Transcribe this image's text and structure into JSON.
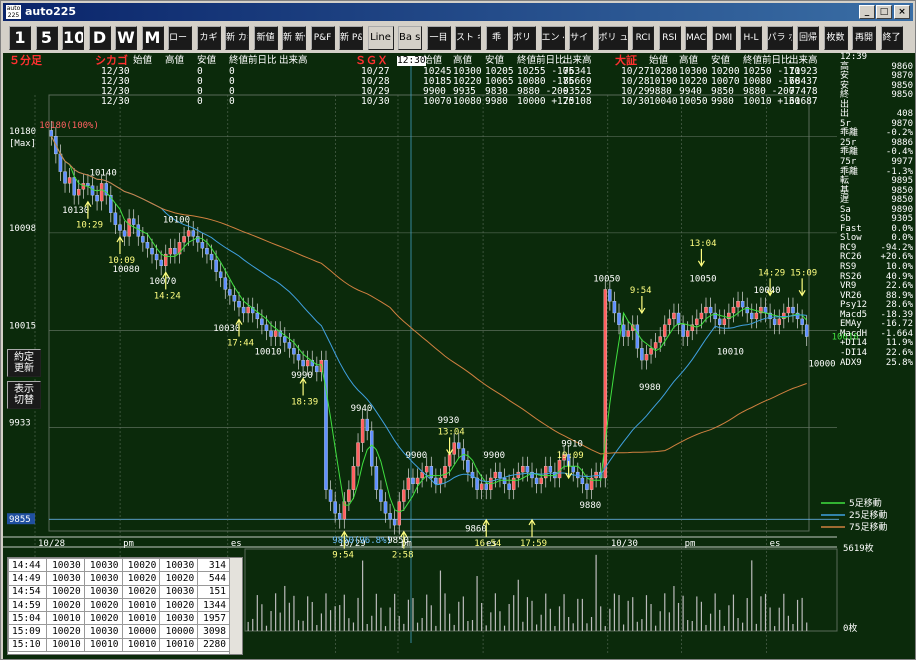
{
  "window": {
    "title": "auto225",
    "icon_text": "auto 225"
  },
  "toolbar": {
    "buttons": [
      "1",
      "5",
      "10",
      "D",
      "W",
      "M",
      "ロー ソク",
      "カギ",
      "新 カギ",
      "新値",
      "新 新値",
      "P&F",
      "新 P&F",
      "Line",
      "Ba sic",
      "一目",
      "スト キャス",
      "乖",
      "ボリ ン",
      "エン ベ",
      "サイ コ",
      "ボリ ューム",
      "RCI",
      "RSI",
      "MAC",
      "DMI",
      "H-L",
      "パラ ボリ",
      "回帰",
      "枚数",
      "再開",
      "終了"
    ]
  },
  "chart_header": {
    "period_label": "５分足",
    "chicago": {
      "label": "シカゴ",
      "cols": [
        "始値",
        "高値",
        "安値",
        "終値前日比",
        "出来高"
      ],
      "rows": [
        [
          "12/30",
          "",
          "",
          "0",
          "0"
        ],
        [
          "12/30",
          "",
          "",
          "0",
          "0"
        ],
        [
          "12/30",
          "",
          "",
          "0",
          "0"
        ],
        [
          "12/30",
          "",
          "",
          "0",
          "0"
        ]
      ]
    },
    "sgx": {
      "label": "ＳＧＸ",
      "time_badge": "12:30",
      "cols": [
        "始値",
        "高値",
        "安値",
        "終値前日比",
        "出来高"
      ],
      "rows": [
        [
          "10/27",
          "10245",
          "10300",
          "10205",
          "10255 -105",
          "76341"
        ],
        [
          "10/28",
          "10185",
          "10220",
          "10065",
          "10080 -175",
          "86669"
        ],
        [
          "10/29",
          "9900",
          "9935",
          "9830",
          "9880 -200",
          "93525"
        ],
        [
          "10/30",
          "10070",
          "10080",
          "9980",
          "10000 +120",
          "75108"
        ]
      ]
    },
    "osaka": {
      "label": "大証",
      "cols": [
        "始値",
        "高値",
        "安値",
        "終値前日比",
        "出来高"
      ],
      "rows": [
        [
          "10/27",
          "10280",
          "10300",
          "10200",
          "10250 -110",
          "71923"
        ],
        [
          "10/28",
          "10190",
          "10220",
          "10070",
          "10080 -170",
          "68437"
        ],
        [
          "10/29",
          "9880",
          "9940",
          "9850",
          "9880 -200",
          "77478"
        ],
        [
          "10/30",
          "10040",
          "10050",
          "9980",
          "10010 +130",
          "61687"
        ]
      ]
    }
  },
  "right_panel": [
    [
      "12:39",
      ""
    ],
    [
      "高",
      "9860"
    ],
    [
      "安",
      "9870"
    ],
    [
      "安",
      "9850"
    ],
    [
      "終",
      "9850"
    ],
    [
      "出",
      ""
    ],
    [
      "出",
      "408"
    ],
    [
      "5r",
      "9870"
    ],
    [
      "乖離",
      "-0.2%"
    ],
    [
      "25r",
      "9886"
    ],
    [
      "乖離",
      "-0.4%"
    ],
    [
      "75r",
      "9977"
    ],
    [
      "乖離",
      "-1.3%"
    ],
    [
      "転",
      "9895"
    ],
    [
      "基",
      "9850"
    ],
    [
      "遅",
      "9850"
    ],
    [
      "Sa",
      "9890"
    ],
    [
      "Sb",
      "9305"
    ],
    [
      "Fast",
      "0.0%"
    ],
    [
      "Slow",
      "0.0%"
    ],
    [
      "RC9",
      "-94.2%"
    ],
    [
      "RC26",
      "+20.6%"
    ],
    [
      "RS9",
      "10.0%"
    ],
    [
      "RS26",
      "40.9%"
    ],
    [
      "VR9",
      "22.6%"
    ],
    [
      "VR26",
      "88.9%"
    ],
    [
      "Psy12",
      "28.6%"
    ],
    [
      "Macd5",
      "-18.39"
    ],
    [
      "EMAy",
      "-16.72"
    ],
    [
      "MacdH",
      "-1.664"
    ],
    [
      "+DI14",
      "11.9%"
    ],
    [
      "-DI14",
      "22.6%"
    ],
    [
      "ADX9",
      "25.8%"
    ]
  ],
  "side_buttons": [
    "約定 更新",
    "表示 切替"
  ],
  "chart_data": {
    "type": "candlestick",
    "y_ticks": [
      {
        "label": "10180",
        "value": 10180
      },
      {
        "label": "10098",
        "value": 10098
      },
      {
        "label": "10015",
        "value": 10015
      },
      {
        "label": "9933",
        "value": 9933
      }
    ],
    "y_max_label": "[Max]",
    "ylim": [
      9845,
      10215
    ],
    "current_price_label": "9855",
    "x_labels": [
      {
        "label": "10/28",
        "at": 0
      },
      {
        "label": "pm",
        "at": 0.15
      },
      {
        "label": "es",
        "at": 0.34
      },
      {
        "label": "10/29",
        "at": 0.53
      },
      {
        "label": "pm",
        "at": 0.64
      },
      {
        "label": "es",
        "at": 0.79
      },
      {
        "label": "10/30",
        "at": 1.01
      },
      {
        "label": "pm",
        "at": 1.14
      },
      {
        "label": "es",
        "at": 1.29
      }
    ],
    "closes": [
      10180,
      10165,
      10150,
      10140,
      10145,
      10130,
      10135,
      10140,
      10138,
      10130,
      10125,
      10140,
      10130,
      10115,
      10105,
      10100,
      10095,
      10110,
      10105,
      10095,
      10090,
      10085,
      10080,
      10075,
      10070,
      10080,
      10085,
      10080,
      10090,
      10095,
      10100,
      10095,
      10090,
      10085,
      10080,
      10075,
      10065,
      10060,
      10050,
      10045,
      10040,
      10035,
      10030,
      10035,
      10030,
      10025,
      10020,
      10015,
      10010,
      10015,
      10010,
      10005,
      10000,
      9995,
      9990,
      9985,
      9990,
      9985,
      9980,
      9990,
      9880,
      9870,
      9860,
      9855,
      9870,
      9880,
      9900,
      9920,
      9940,
      9930,
      9900,
      9880,
      9870,
      9860,
      9855,
      9850,
      9870,
      9880,
      9890,
      9885,
      9890,
      9895,
      9900,
      9890,
      9885,
      9890,
      9900,
      9910,
      9920,
      9915,
      9905,
      9895,
      9890,
      9880,
      9885,
      9880,
      9890,
      9895,
      9890,
      9885,
      9880,
      9890,
      9895,
      9900,
      9895,
      9890,
      9885,
      9890,
      9900,
      9895,
      9890,
      9905,
      9910,
      9900,
      9895,
      9890,
      9885,
      9880,
      9890,
      9895,
      9890,
      10050,
      10040,
      10030,
      10020,
      10010,
      10015,
      10020,
      10000,
      9990,
      9995,
      10000,
      10005,
      10010,
      10020,
      10025,
      10030,
      10020,
      10010,
      10015,
      10020,
      10025,
      10030,
      10035,
      10030,
      10025,
      10020,
      10025,
      10030,
      10035,
      10040,
      10035,
      10030,
      10025,
      10030,
      10035,
      10030,
      10025,
      10020,
      10025,
      10030,
      10035,
      10030,
      10025,
      10020,
      10010
    ],
    "price_labels": [
      {
        "text": "10180(100%)",
        "i": 0,
        "v": 10180,
        "pos": "above"
      },
      {
        "text": "10140",
        "i": 11,
        "v": 10140,
        "pos": "above"
      },
      {
        "text": "10130",
        "i": 5,
        "v": 10130,
        "pos": "below"
      },
      {
        "text": "10100",
        "i": 27,
        "v": 10100,
        "pos": "above"
      },
      {
        "text": "10080",
        "i": 16,
        "v": 10080,
        "pos": "below"
      },
      {
        "text": "10070",
        "i": 24,
        "v": 10070,
        "pos": "below"
      },
      {
        "text": "10030",
        "i": 38,
        "v": 10030,
        "pos": "below"
      },
      {
        "text": "10010",
        "i": 47,
        "v": 10010,
        "pos": "below"
      },
      {
        "text": "9990",
        "i": 55,
        "v": 9990,
        "pos": "below"
      },
      {
        "text": "9940",
        "i": 68,
        "v": 9940,
        "pos": "above"
      },
      {
        "text": "9850(96.8%)",
        "i": 64,
        "v": 9850,
        "pos": "below"
      },
      {
        "text": "9850",
        "i": 76,
        "v": 9850,
        "pos": "below"
      },
      {
        "text": "9900",
        "i": 80,
        "v": 9900,
        "pos": "above"
      },
      {
        "text": "9930",
        "i": 87,
        "v": 9930,
        "pos": "above"
      },
      {
        "text": "9900",
        "i": 97,
        "v": 9900,
        "pos": "above"
      },
      {
        "text": "9860",
        "i": 93,
        "v": 9860,
        "pos": "below"
      },
      {
        "text": "9910",
        "i": 114,
        "v": 9910,
        "pos": "above"
      },
      {
        "text": "9880",
        "i": 118,
        "v": 9880,
        "pos": "below"
      },
      {
        "text": "10050",
        "i": 121,
        "v": 10050,
        "pos": "above"
      },
      {
        "text": "9980",
        "i": 131,
        "v": 9980,
        "pos": "below"
      },
      {
        "text": "10050",
        "i": 142,
        "v": 10050,
        "pos": "above"
      },
      {
        "text": "10010",
        "i": 148,
        "v": 10010,
        "pos": "below"
      },
      {
        "text": "10040",
        "i": 156,
        "v": 10040,
        "pos": "above"
      },
      {
        "text": "10000",
        "i": 168,
        "v": 10000,
        "pos": "below"
      },
      {
        "text": "10010",
        "i": 170,
        "v": 10010,
        "pos": "right"
      }
    ],
    "time_marks": [
      {
        "text": "10:29",
        "i": 8,
        "v": 10110,
        "dir": "up"
      },
      {
        "text": "10:09",
        "i": 15,
        "v": 10080,
        "dir": "up"
      },
      {
        "text": "14:24",
        "i": 25,
        "v": 10050,
        "dir": "up"
      },
      {
        "text": "17:44",
        "i": 41,
        "v": 10010,
        "dir": "up"
      },
      {
        "text": "18:39",
        "i": 55,
        "v": 9960,
        "dir": "up"
      },
      {
        "text": "9:54",
        "i": 64,
        "v": 9830,
        "dir": "up"
      },
      {
        "text": "2:58",
        "i": 77,
        "v": 9830,
        "dir": "up"
      },
      {
        "text": "13:04",
        "i": 87,
        "v": 9910,
        "dir": "down"
      },
      {
        "text": "16:54",
        "i": 95,
        "v": 9840,
        "dir": "up"
      },
      {
        "text": "17:59",
        "i": 105,
        "v": 9840,
        "dir": "up"
      },
      {
        "text": "19:09",
        "i": 113,
        "v": 9890,
        "dir": "down"
      },
      {
        "text": "9:54",
        "i": 129,
        "v": 10030,
        "dir": "down"
      },
      {
        "text": "13:04",
        "i": 142,
        "v": 10070,
        "dir": "down"
      },
      {
        "text": "14:29",
        "i": 157,
        "v": 10045,
        "dir": "down"
      },
      {
        "text": "15:09",
        "i": 164,
        "v": 10045,
        "dir": "down"
      }
    ],
    "series": [
      {
        "name": "5足移動",
        "color": "#40e040"
      },
      {
        "name": "25足移動",
        "color": "#40a0e0"
      },
      {
        "name": "75足移動",
        "color": "#d08040"
      }
    ],
    "volume_max_label": "5619枚",
    "volume_min_label": "0枚",
    "colors": {
      "up": "#ff6060",
      "down": "#6090ff",
      "bg": "#0b2a0b",
      "grid": "#6a7a6a"
    }
  },
  "ticks": [
    [
      "14:44",
      "10030",
      "10030",
      "10020",
      "10030",
      "314"
    ],
    [
      "14:49",
      "10030",
      "10030",
      "10020",
      "10020",
      "544"
    ],
    [
      "14:54",
      "10020",
      "10030",
      "10020",
      "10030",
      "151"
    ],
    [
      "14:59",
      "10020",
      "10020",
      "10010",
      "10020",
      "1344"
    ],
    [
      "15:04",
      "10010",
      "10020",
      "10010",
      "10030",
      "1957"
    ],
    [
      "15:09",
      "10020",
      "10030",
      "10000",
      "10000",
      "3098"
    ],
    [
      "15:10",
      "10010",
      "10010",
      "10010",
      "10010",
      "2280"
    ]
  ]
}
